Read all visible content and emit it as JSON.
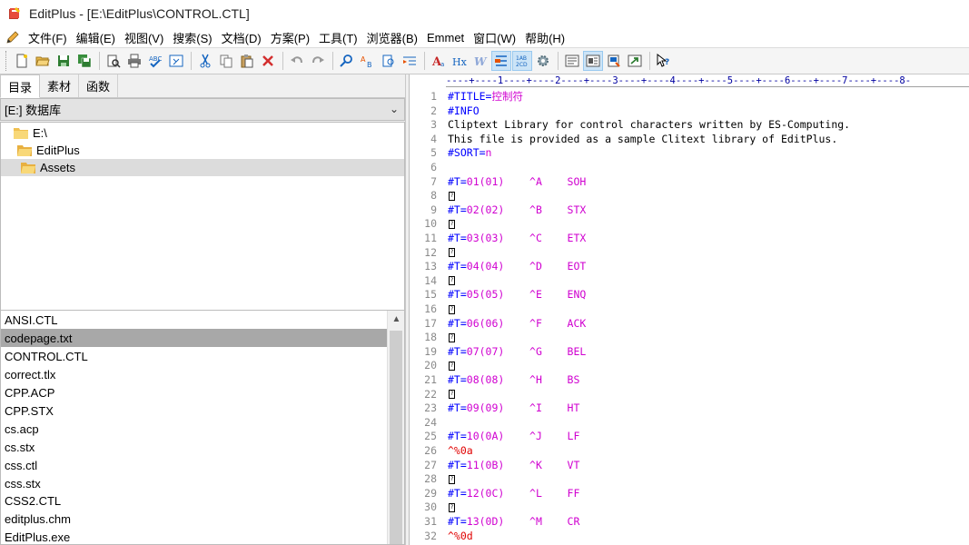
{
  "window": {
    "title": "EditPlus - [E:\\EditPlus\\CONTROL.CTL]",
    "app_icon": "editplus-book-icon"
  },
  "menu": {
    "items": [
      "文件(F)",
      "编辑(E)",
      "视图(V)",
      "搜索(S)",
      "文档(D)",
      "方案(P)",
      "工具(T)",
      "浏览器(B)",
      "Emmet",
      "窗口(W)",
      "帮助(H)"
    ]
  },
  "toolbar": {
    "buttons": [
      "new-file-icon",
      "open-folder-icon",
      "save-icon",
      "save-all-icon",
      "print-preview-icon",
      "print-icon",
      "spell-check-icon",
      "browser-preview-icon",
      "cut-icon",
      "copy-icon",
      "paste-icon",
      "delete-icon",
      "undo-icon",
      "redo-icon",
      "find-icon",
      "replace-icon",
      "find-in-files-icon",
      "indent-icon",
      "font-icon",
      "hx-heading-icon",
      "word-wrap-icon",
      "line-number-icon",
      "column-ruler-icon",
      "settings-icon",
      "text-view-icon",
      "html-view-icon",
      "book-icon",
      "export-icon",
      "help-cursor-icon"
    ]
  },
  "sidebar": {
    "tabs": [
      "目录",
      "素材",
      "函数"
    ],
    "selected_tab": "目录",
    "drive": "[E:] 数据库",
    "tree": [
      {
        "label": "E:\\",
        "indent": 0
      },
      {
        "label": "EditPlus",
        "indent": 1
      },
      {
        "label": "Assets",
        "indent": 2,
        "selected": true
      }
    ],
    "files": [
      "ANSI.CTL",
      "codepage.txt",
      "CONTROL.CTL",
      "correct.tlx",
      "CPP.ACP",
      "CPP.STX",
      "cs.acp",
      "cs.stx",
      "css.ctl",
      "css.stx",
      "CSS2.CTL",
      "editplus.chm",
      "EditPlus.exe"
    ],
    "selected_file": "codepage.txt"
  },
  "editor": {
    "ruler": "----+----1----+----2----+----3----+----4----+----5----+----6----+----7----+----8-",
    "lines": [
      {
        "n": "1",
        "parts": [
          [
            "#TITLE=",
            "blue"
          ],
          [
            "控制符",
            "magenta"
          ]
        ]
      },
      {
        "n": "2",
        "parts": [
          [
            "#INFO",
            "blue"
          ]
        ]
      },
      {
        "n": "3",
        "parts": [
          [
            "Cliptext Library for control characters written by ES-Computing.",
            "black"
          ]
        ]
      },
      {
        "n": "4",
        "parts": [
          [
            "This file is provided as a sample Clitext library of EditPlus.",
            "black"
          ]
        ]
      },
      {
        "n": "5",
        "parts": [
          [
            "#SORT=",
            "blue"
          ],
          [
            "n",
            "magenta"
          ]
        ]
      },
      {
        "n": "6",
        "parts": []
      },
      {
        "n": "7",
        "parts": [
          [
            "#T=",
            "blue"
          ],
          [
            "01(01)    ^A    SOH",
            "magenta"
          ]
        ]
      },
      {
        "n": "8",
        "parts": [
          [
            "?",
            "box"
          ]
        ]
      },
      {
        "n": "9",
        "parts": [
          [
            "#T=",
            "blue"
          ],
          [
            "02(02)    ^B    STX",
            "magenta"
          ]
        ]
      },
      {
        "n": "10",
        "parts": [
          [
            "?",
            "box"
          ]
        ]
      },
      {
        "n": "11",
        "parts": [
          [
            "#T=",
            "blue"
          ],
          [
            "03(03)    ^C    ETX",
            "magenta"
          ]
        ]
      },
      {
        "n": "12",
        "parts": [
          [
            "?",
            "box"
          ]
        ]
      },
      {
        "n": "13",
        "parts": [
          [
            "#T=",
            "blue"
          ],
          [
            "04(04)    ^D    EOT",
            "magenta"
          ]
        ]
      },
      {
        "n": "14",
        "parts": [
          [
            "?",
            "box"
          ]
        ]
      },
      {
        "n": "15",
        "parts": [
          [
            "#T=",
            "blue"
          ],
          [
            "05(05)    ^E    ENQ",
            "magenta"
          ]
        ]
      },
      {
        "n": "16",
        "parts": [
          [
            "?",
            "box"
          ]
        ]
      },
      {
        "n": "17",
        "parts": [
          [
            "#T=",
            "blue"
          ],
          [
            "06(06)    ^F    ACK",
            "magenta"
          ]
        ]
      },
      {
        "n": "18",
        "parts": [
          [
            "?",
            "box"
          ]
        ]
      },
      {
        "n": "19",
        "parts": [
          [
            "#T=",
            "blue"
          ],
          [
            "07(07)    ^G    BEL",
            "magenta"
          ]
        ]
      },
      {
        "n": "20",
        "parts": [
          [
            "?",
            "box"
          ]
        ]
      },
      {
        "n": "21",
        "parts": [
          [
            "#T=",
            "blue"
          ],
          [
            "08(08)    ^H    BS",
            "magenta"
          ]
        ]
      },
      {
        "n": "22",
        "parts": [
          [
            "?",
            "box"
          ]
        ]
      },
      {
        "n": "23",
        "parts": [
          [
            "#T=",
            "blue"
          ],
          [
            "09(09)    ^I    HT",
            "magenta"
          ]
        ]
      },
      {
        "n": "24",
        "parts": []
      },
      {
        "n": "25",
        "parts": [
          [
            "#T=",
            "blue"
          ],
          [
            "10(0A)    ^J    LF",
            "magenta"
          ]
        ]
      },
      {
        "n": "26",
        "parts": [
          [
            "^%0a",
            "red"
          ]
        ]
      },
      {
        "n": "27",
        "parts": [
          [
            "#T=",
            "blue"
          ],
          [
            "11(0B)    ^K    VT",
            "magenta"
          ]
        ]
      },
      {
        "n": "28",
        "parts": [
          [
            "?",
            "box"
          ]
        ]
      },
      {
        "n": "29",
        "parts": [
          [
            "#T=",
            "blue"
          ],
          [
            "12(0C)    ^L    FF",
            "magenta"
          ]
        ]
      },
      {
        "n": "30",
        "parts": [
          [
            "?",
            "box"
          ]
        ]
      },
      {
        "n": "31",
        "parts": [
          [
            "#T=",
            "blue"
          ],
          [
            "13(0D)    ^M    CR",
            "magenta"
          ]
        ]
      },
      {
        "n": "32",
        "parts": [
          [
            "^%0d",
            "red"
          ]
        ]
      }
    ]
  },
  "colors": {
    "keyword": "#0000ff",
    "value": "#d000d0",
    "escape": "#e00000",
    "line_number": "#8a8a8a"
  }
}
